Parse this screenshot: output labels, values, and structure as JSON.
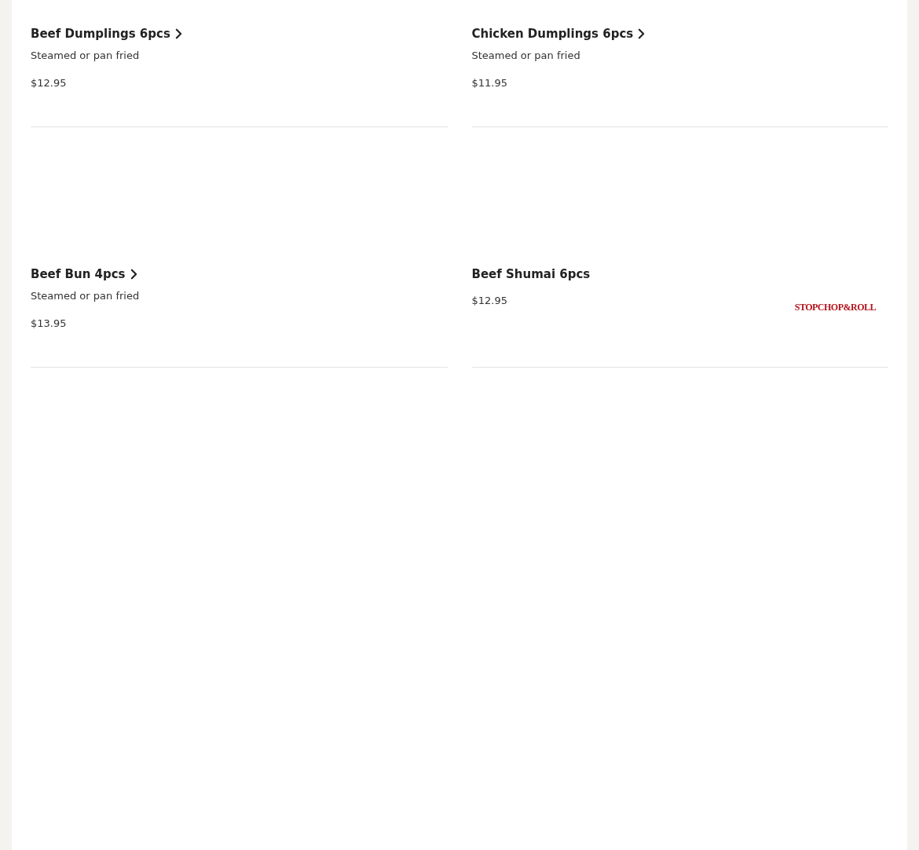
{
  "menu_items": [
    {
      "name": "Beef Dumplings 6pcs",
      "has_details": true,
      "description": "Steamed or pan fried",
      "price": "$12.95"
    },
    {
      "name": "Chicken Dumplings 6pcs",
      "has_details": true,
      "description": "Steamed or pan fried",
      "price": "$11.95"
    },
    {
      "name": "Beef Bun 4pcs",
      "has_details": true,
      "description": "Steamed or pan fried",
      "price": "$13.95"
    },
    {
      "name": "Beef Shumai 6pcs",
      "has_details": false,
      "price": "$12.95",
      "logo": {
        "text": "STOPCHOP&ROLL"
      }
    }
  ]
}
